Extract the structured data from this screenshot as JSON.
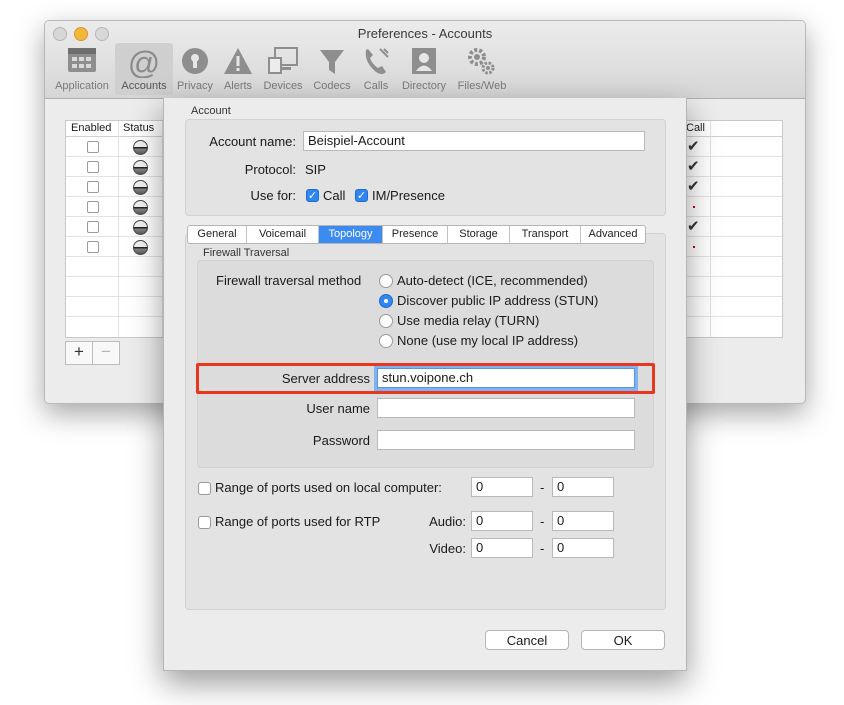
{
  "window": {
    "title": "Preferences - Accounts",
    "toolbar": [
      {
        "label": "Application",
        "icon": "application-icon"
      },
      {
        "label": "Accounts",
        "icon": "at-icon",
        "selected": true
      },
      {
        "label": "Privacy",
        "icon": "privacy-icon"
      },
      {
        "label": "Alerts",
        "icon": "alert-icon"
      },
      {
        "label": "Devices",
        "icon": "devices-icon"
      },
      {
        "label": "Codecs",
        "icon": "funnel-icon"
      },
      {
        "label": "Calls",
        "icon": "phone-icon"
      },
      {
        "label": "Directory",
        "icon": "contact-icon"
      },
      {
        "label": "Files/Web",
        "icon": "gears-icon"
      }
    ],
    "accounts_table": {
      "headers": {
        "enabled": "Enabled",
        "status": "Status",
        "call": "Call"
      },
      "call_marks": [
        "check",
        "check",
        "check",
        "dot",
        "check",
        "dot"
      ]
    },
    "add_label": "+",
    "remove_label": "−"
  },
  "account": {
    "group_title": "Account",
    "name_label": "Account name:",
    "name_value": "Beispiel-Account",
    "protocol_label": "Protocol:",
    "protocol_value": "SIP",
    "usefor_label": "Use for:",
    "use_call": "Call",
    "use_im": "IM/Presence"
  },
  "tabs": [
    "General",
    "Voicemail",
    "Topology",
    "Presence",
    "Storage",
    "Transport",
    "Advanced"
  ],
  "selected_tab": "Topology",
  "firewall": {
    "group_title": "Firewall Traversal",
    "method_label": "Firewall traversal method",
    "options": [
      "Auto-detect (ICE, recommended)",
      "Discover public IP address (STUN)",
      "Use media relay (TURN)",
      "None (use my local IP address)"
    ],
    "selected_option": 1,
    "server_label": "Server address",
    "server_value": "stun.voipone.ch",
    "user_label": "User name",
    "user_value": "",
    "password_label": "Password",
    "password_value": ""
  },
  "ports": {
    "local_label": "Range of ports used on local computer:",
    "local_from": "0",
    "local_to": "0",
    "rtp_label": "Range of ports used for RTP",
    "audio_label": "Audio:",
    "audio_from": "0",
    "audio_to": "0",
    "video_label": "Video:",
    "video_from": "0",
    "video_to": "0",
    "separator": "-"
  },
  "buttons": {
    "cancel": "Cancel",
    "ok": "OK"
  },
  "colors": {
    "accent": "#2f86f0",
    "highlight": "#e8361f"
  }
}
